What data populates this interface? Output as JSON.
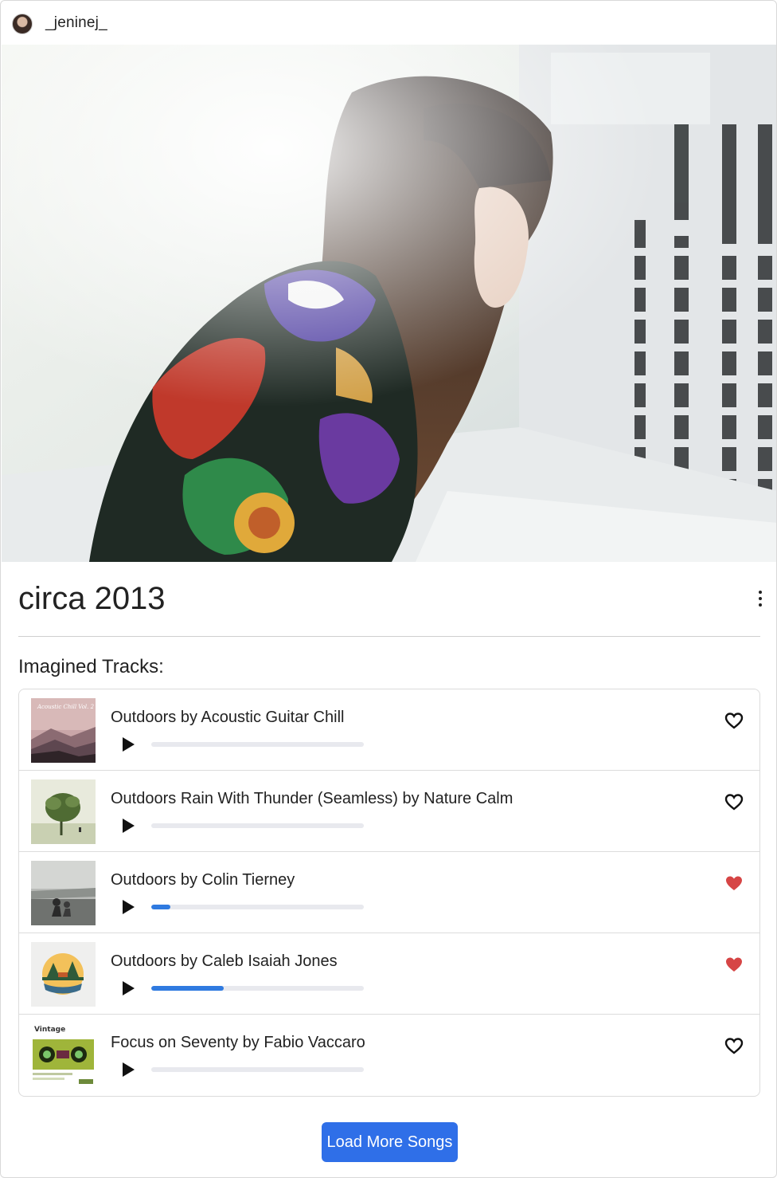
{
  "header": {
    "username": "_jeninej_"
  },
  "post": {
    "title": "circa 2013",
    "section_label": "Imagined Tracks:"
  },
  "tracks": [
    {
      "title": "Outdoors by Acoustic Guitar Chill",
      "progress": 0,
      "liked": false
    },
    {
      "title": "Outdoors Rain With Thunder (Seamless) by Nature Calm",
      "progress": 0,
      "liked": false
    },
    {
      "title": "Outdoors by Colin Tierney",
      "progress": 0.09,
      "liked": true
    },
    {
      "title": "Outdoors by Caleb Isaiah Jones",
      "progress": 0.34,
      "liked": true
    },
    {
      "title": "Focus on Seventy by Fabio Vaccaro",
      "progress": 0,
      "liked": false
    }
  ],
  "thumb_text": {
    "vintage": "Vintage",
    "acoustic": "Acoustic Chill Vol. 2"
  },
  "load_more_label": "Load More Songs",
  "colors": {
    "accent": "#2f6fe8",
    "progress": "#2f7ae0",
    "liked": "#d64545"
  },
  "icons": {
    "play": "play-icon",
    "heart_outline": "heart-outline-icon",
    "heart_filled": "heart-filled-icon",
    "menu": "kebab-menu-icon"
  }
}
